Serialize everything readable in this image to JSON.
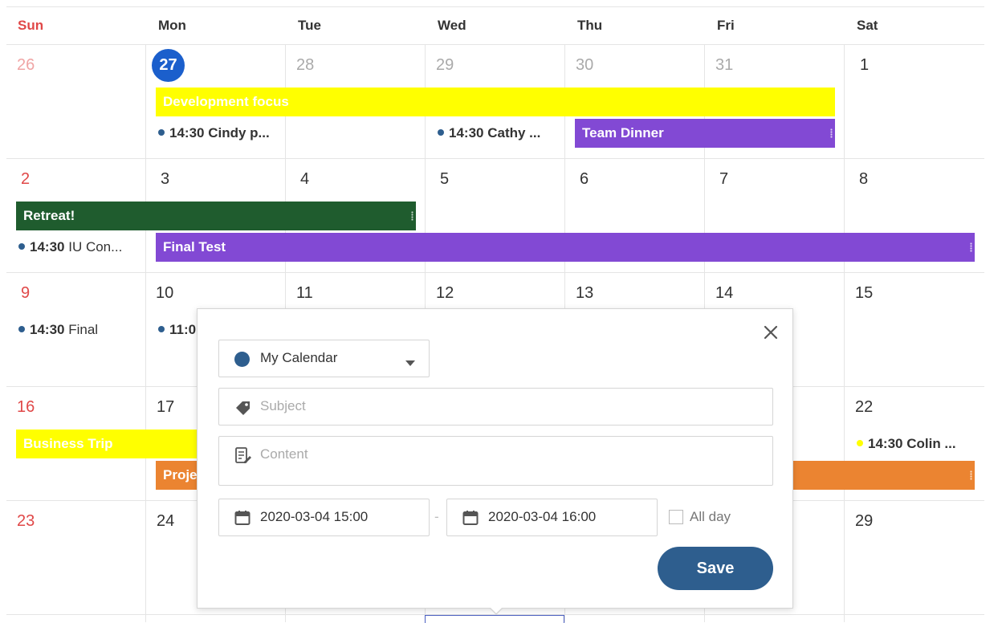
{
  "weekdays": [
    "Sun",
    "Mon",
    "Tue",
    "Wed",
    "Thu",
    "Fri",
    "Sat"
  ],
  "weeks": [
    [
      "26",
      "27",
      "28",
      "29",
      "30",
      "31",
      "1"
    ],
    [
      "2",
      "3",
      "4",
      "5",
      "6",
      "7",
      "8"
    ],
    [
      "9",
      "10",
      "11",
      "12",
      "13",
      "14",
      "15"
    ],
    [
      "16",
      "17",
      "",
      "",
      "",
      "",
      "22"
    ],
    [
      "23",
      "24",
      "",
      "",
      "",
      "",
      "29"
    ]
  ],
  "events": {
    "development_focus": "Development focus",
    "team_dinner": "Team Dinner",
    "retreat": "Retreat!",
    "final_test": "Final Test",
    "business_trip": "Business Trip",
    "project": "Proje",
    "mon27_time": "14:30",
    "mon27_title": "Cindy p...",
    "wed29_time": "14:30",
    "wed29_title": "Cathy ...",
    "sun2_time": "14:30",
    "sun2_title": "IU Con...",
    "sun9_time": "14:30",
    "sun9_title": "Final",
    "mon10_time": "11:0",
    "sat22_time": "14:30",
    "sat22_title": "Colin ..."
  },
  "colors": {
    "yellow": "#ffff00",
    "purple": "#8249d4",
    "dark_green": "#1f5c2e",
    "orange": "#eb8431",
    "calendar_dot": "#2e5e8e",
    "today": "#1b5fcc",
    "sunday": "#e04848"
  },
  "popup": {
    "calendar": "My Calendar",
    "subject_placeholder": "Subject",
    "content_placeholder": "Content",
    "start": "2020-03-04 15:00",
    "separator": "-",
    "end": "2020-03-04 16:00",
    "allday_label": "All day",
    "save_label": "Save"
  },
  "icons": {
    "close": "close-icon",
    "dropdown": "caret-down-icon",
    "subject": "tag-icon",
    "content": "note-edit-icon",
    "date": "calendar-icon"
  }
}
